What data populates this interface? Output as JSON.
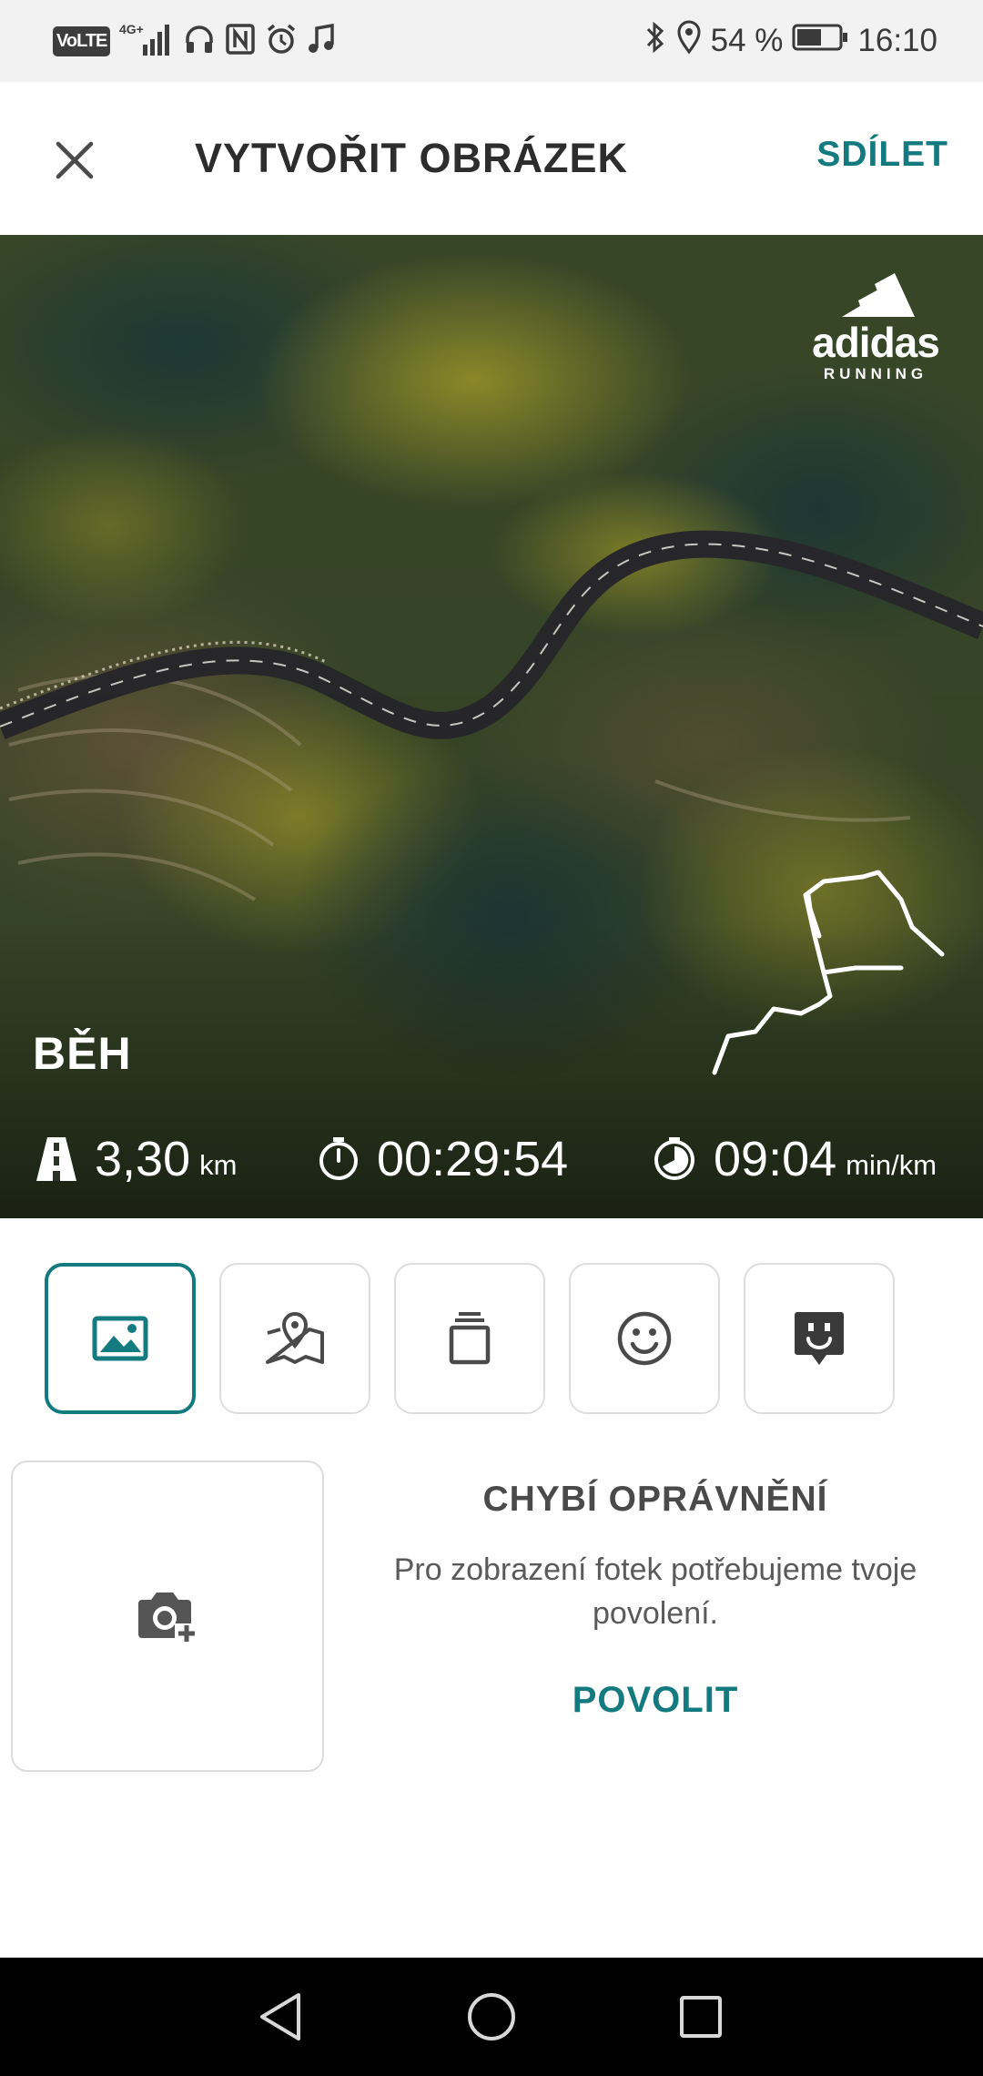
{
  "status_bar": {
    "network_badge": "VoLTE",
    "network_type": "4G+",
    "battery_percent": "54 %",
    "time": "16:10",
    "icons": [
      "signal-icon",
      "headphones-icon",
      "nfc-icon",
      "alarm-icon",
      "music-icon",
      "bluetooth-icon",
      "location-icon",
      "battery-icon"
    ]
  },
  "header": {
    "title": "VYTVOŘIT OBRÁZEK",
    "share_label": "SDÍLET",
    "close_icon": "close-icon"
  },
  "photo_card": {
    "brand": {
      "word": "adidas",
      "sub": "RUNNING"
    },
    "activity": "BĚH",
    "stats": [
      {
        "icon": "road-icon",
        "value": "3,30",
        "unit": "km"
      },
      {
        "icon": "stopwatch-icon",
        "value": "00:29:54",
        "unit": ""
      },
      {
        "icon": "pace-icon",
        "value": "09:04",
        "unit": "min/km"
      }
    ]
  },
  "toolbar": {
    "tools": [
      {
        "icon": "image-icon",
        "selected": true
      },
      {
        "icon": "map-icon",
        "selected": false
      },
      {
        "icon": "layers-icon",
        "selected": false
      },
      {
        "icon": "smiley-icon",
        "selected": false
      },
      {
        "icon": "sticker-icon",
        "selected": false
      }
    ]
  },
  "permission": {
    "camera_icon": "camera-add-icon",
    "title": "CHYBÍ OPRÁVNĚNÍ",
    "text": "Pro zobrazení fotek potřebujeme tvoje povolení.",
    "button_label": "POVOLIT"
  },
  "nav_bar": {
    "buttons": [
      "back-icon",
      "home-icon",
      "recents-icon"
    ]
  },
  "colors": {
    "accent": "#137a80",
    "status_bar_bg": "#f2f2f2",
    "nav_bg": "#000000"
  }
}
